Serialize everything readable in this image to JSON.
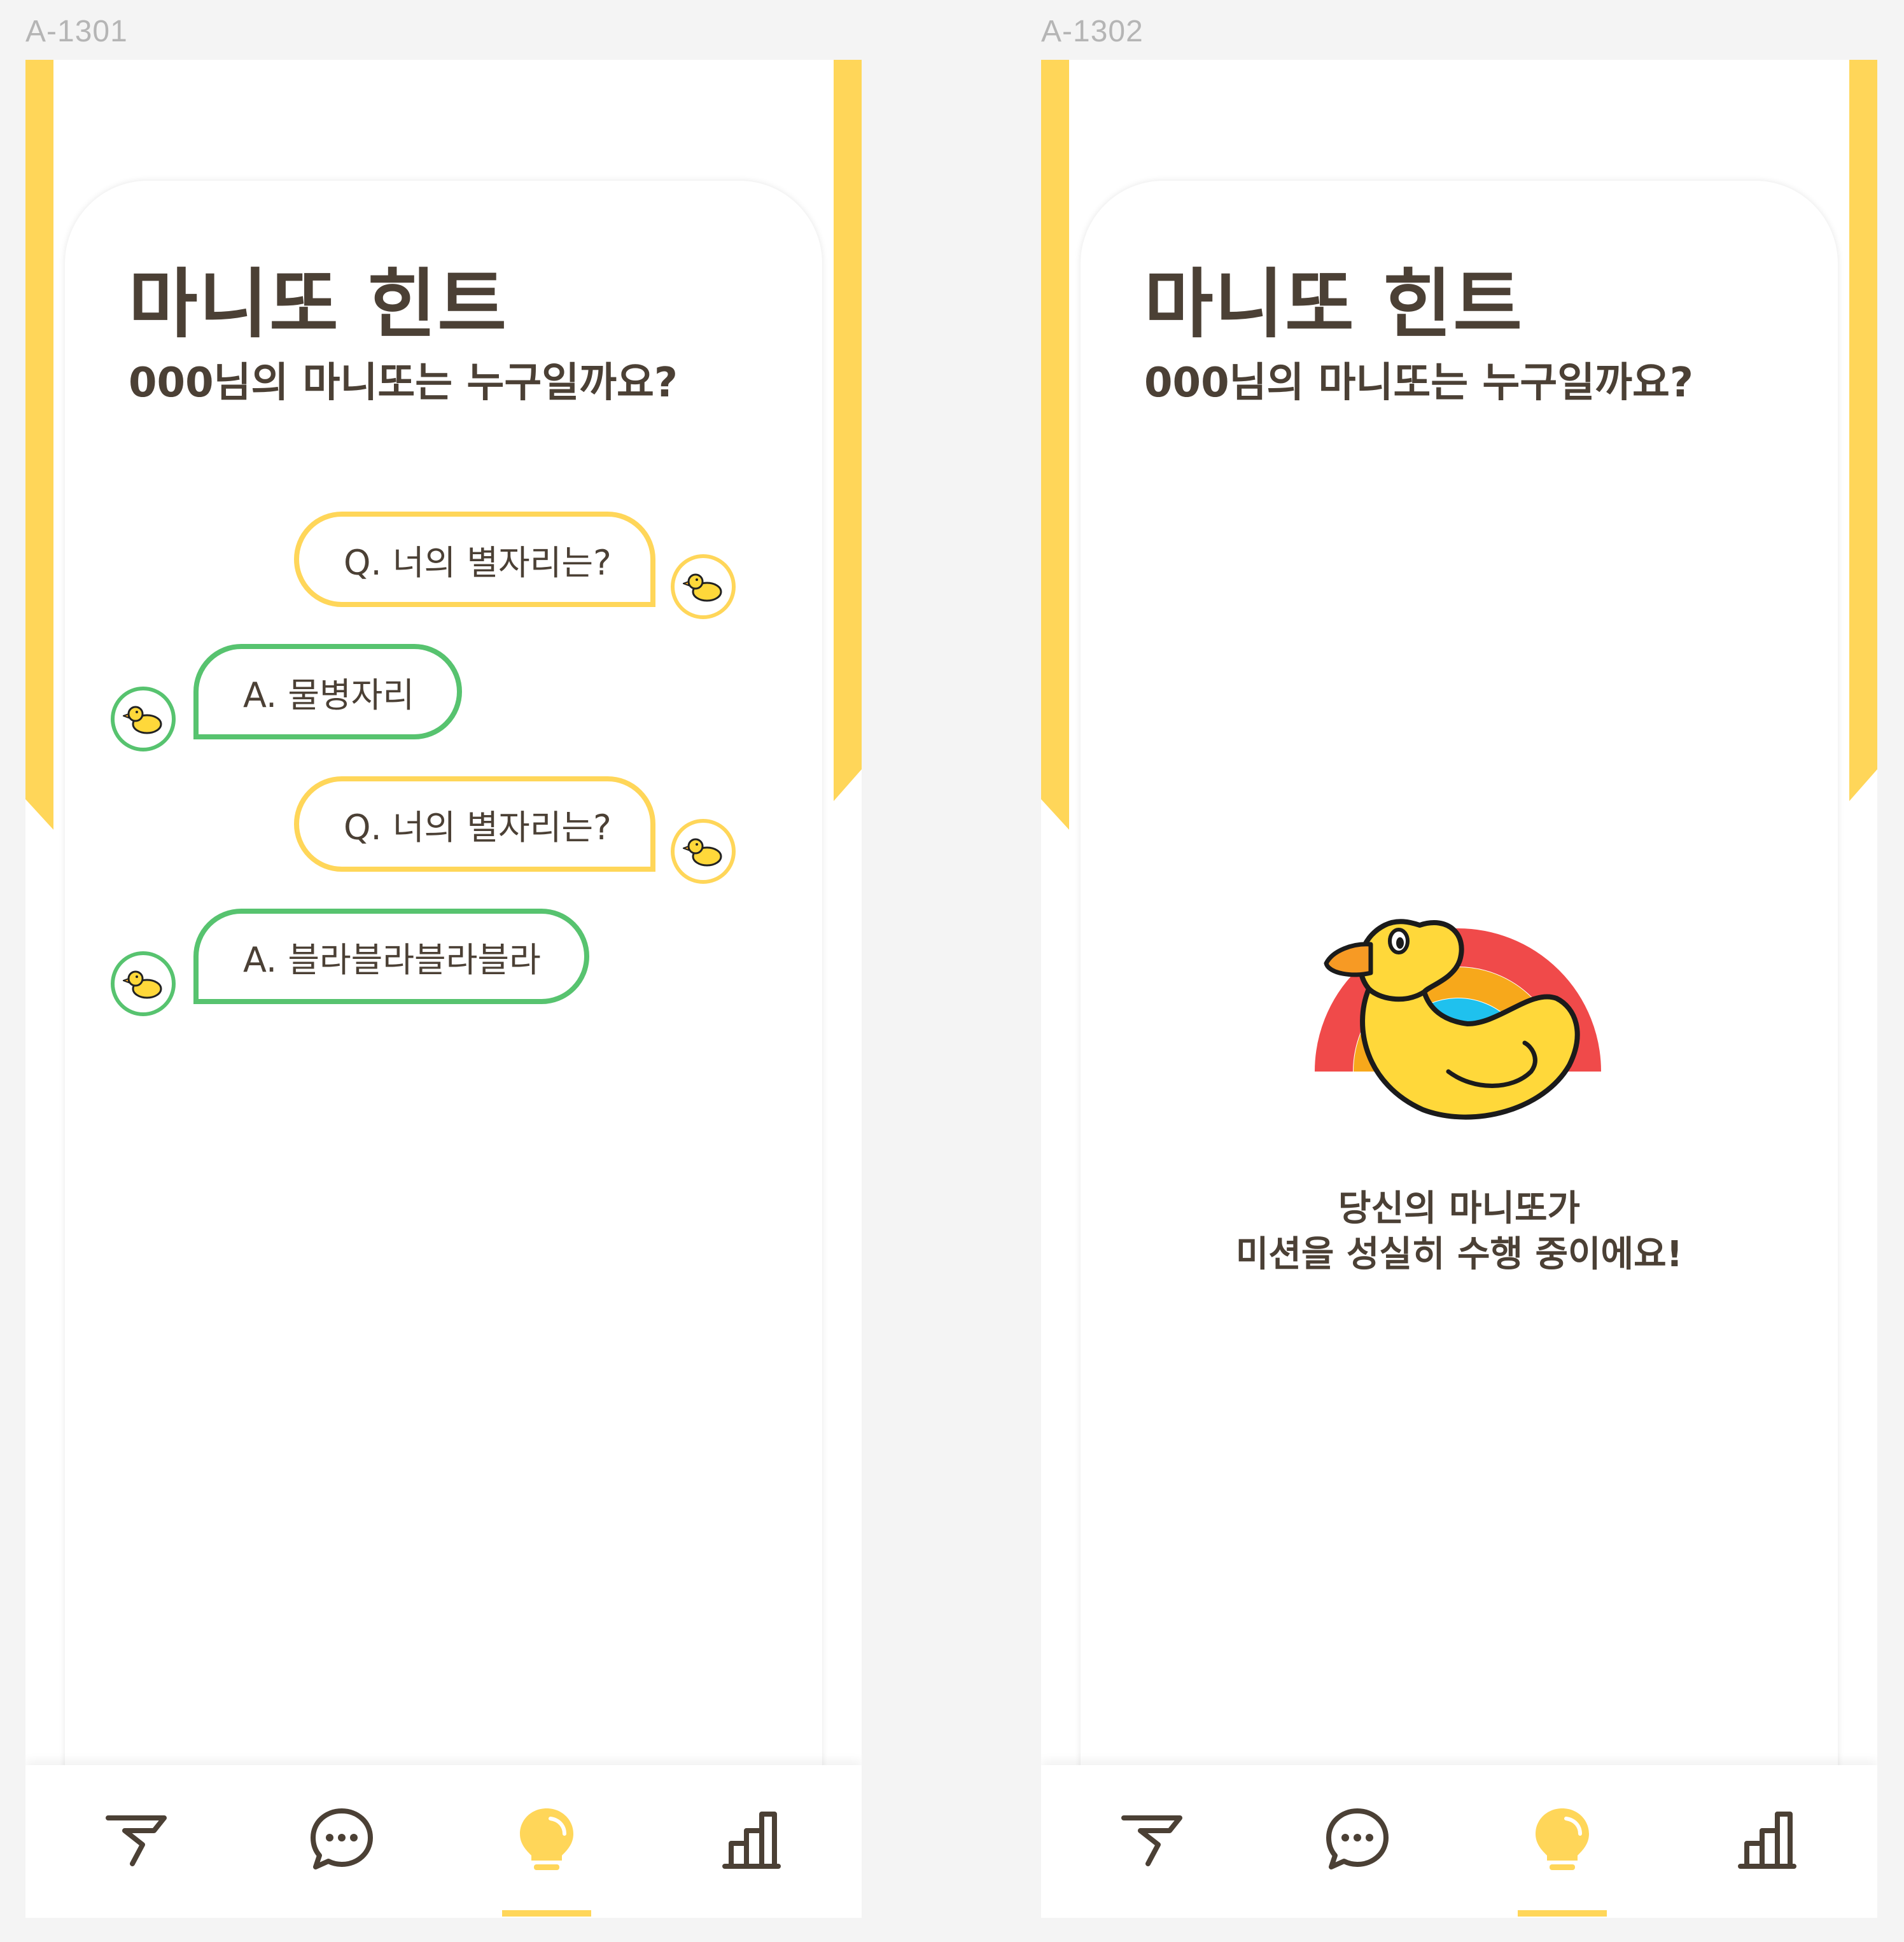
{
  "colors": {
    "accent_yellow": "#ffd659",
    "answer_green": "#57c36f",
    "text_brown": "#4b4035",
    "label_gray": "#b5b5b5",
    "icon_dark": "#4b4035"
  },
  "screens": [
    {
      "label": "A-1301",
      "title": "마니또 힌트",
      "subtitle": "000님의 마니또는 누구일까요?",
      "messages": [
        {
          "type": "question",
          "text": "Q. 너의 별자리는?",
          "avatar_icon": "duck-icon"
        },
        {
          "type": "answer",
          "text": "A. 물병자리",
          "avatar_icon": "duck-icon"
        },
        {
          "type": "question",
          "text": "Q. 너의 별자리는?",
          "avatar_icon": "duck-icon"
        },
        {
          "type": "answer",
          "text": "A. 블라블라블라블라",
          "avatar_icon": "duck-icon"
        }
      ],
      "tabs": [
        {
          "icon": "flag-icon",
          "active": false
        },
        {
          "icon": "chat-icon",
          "active": false
        },
        {
          "icon": "lightbulb-icon",
          "active": true
        },
        {
          "icon": "bar-chart-icon",
          "active": false
        }
      ]
    },
    {
      "label": "A-1302",
      "title": "마니또 힌트",
      "subtitle": "000님의 마니또는 누구일까요?",
      "illustration": "duck-rainbow-illustration",
      "status_line1": "당신의 마니또가",
      "status_line2": "미션을 성실히 수행 중이에요!",
      "tabs": [
        {
          "icon": "flag-icon",
          "active": false
        },
        {
          "icon": "chat-icon",
          "active": false
        },
        {
          "icon": "lightbulb-icon",
          "active": true
        },
        {
          "icon": "bar-chart-icon",
          "active": false
        }
      ]
    }
  ]
}
